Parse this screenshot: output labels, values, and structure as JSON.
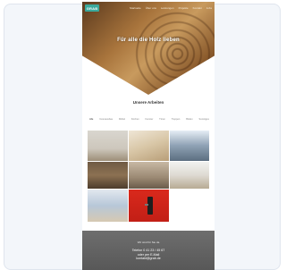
{
  "header": {
    "logo": "GRAB",
    "nav": [
      "Startseite",
      "Über uns",
      "Leistungen",
      "Projekte",
      "Kontakt",
      "Jobs"
    ]
  },
  "hero": {
    "title": "Für alle die Holz lieben"
  },
  "projects": {
    "title": "Unsere Arbeiten",
    "filters": [
      "Alle",
      "Innenausbau",
      "Möbel",
      "Küchen",
      "Fenster",
      "Türen",
      "Treppen",
      "Böden",
      "Sonstiges"
    ]
  },
  "contact": {
    "line1": "Wir sind für Sie da",
    "line2": "Telefon 0 41 23 / 45 67",
    "line3": "oder per E-Mail",
    "line4": "kontakt@grab.de"
  }
}
